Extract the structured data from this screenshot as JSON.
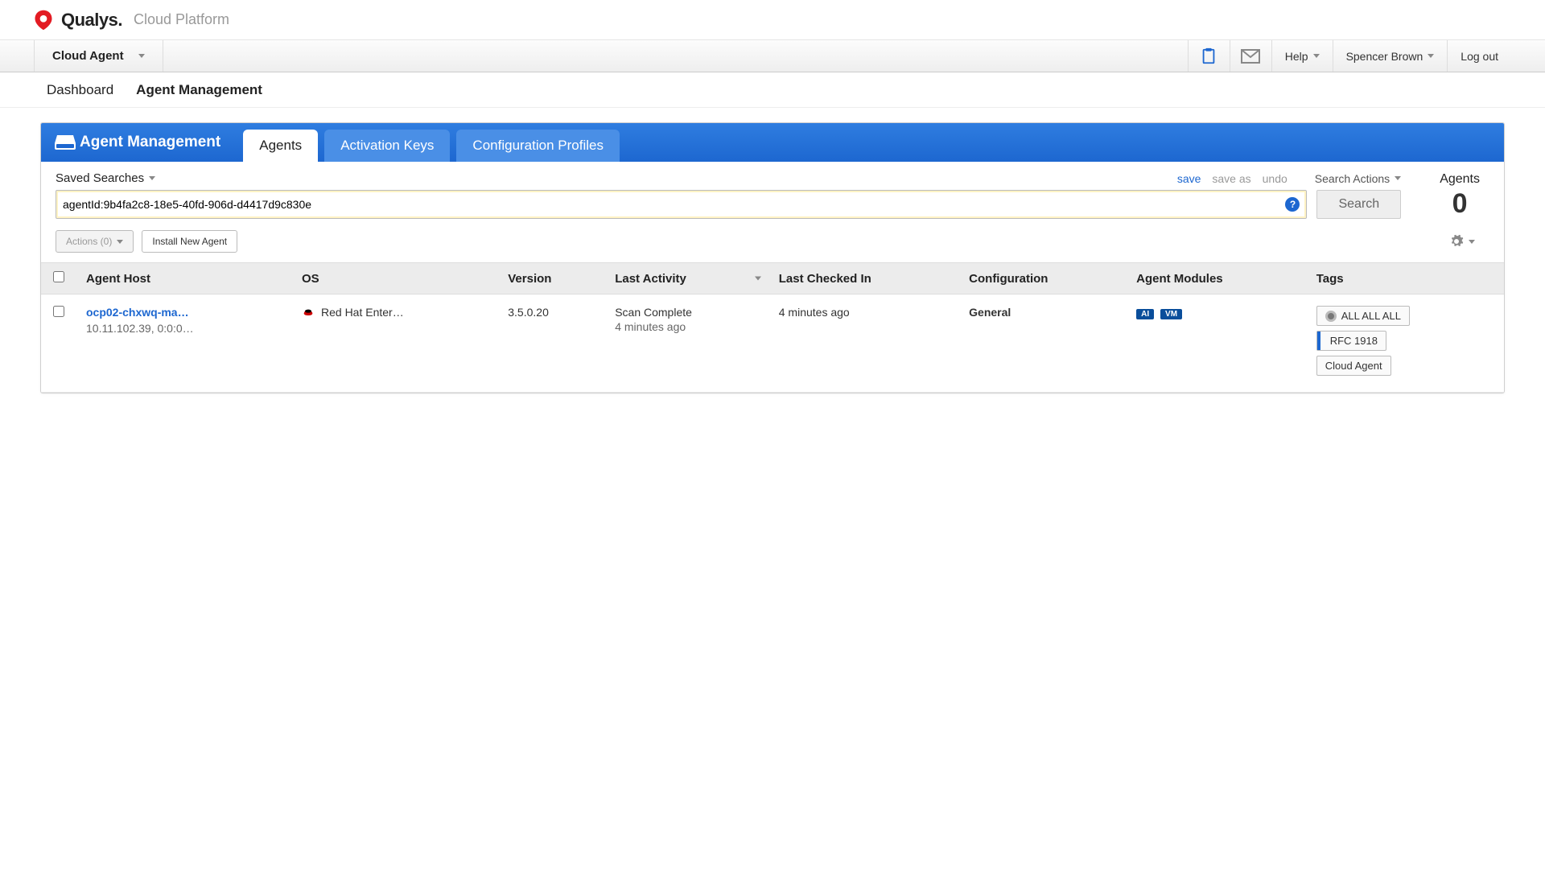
{
  "brand": {
    "name": "Qualys.",
    "sub": "Cloud Platform"
  },
  "topbar": {
    "product": "Cloud Agent",
    "help": "Help",
    "user": "Spencer Brown",
    "logout": "Log out"
  },
  "secondaryNav": {
    "items": [
      "Dashboard",
      "Agent Management"
    ],
    "activeIndex": 1
  },
  "blueHeader": {
    "title": "Agent Management",
    "tabs": [
      "Agents",
      "Activation Keys",
      "Configuration Profiles"
    ],
    "activeIndex": 0
  },
  "searchArea": {
    "savedSearches": "Saved Searches",
    "save": "save",
    "saveAs": "save as",
    "undo": "undo",
    "searchActions": "Search Actions",
    "agentsLabel": "Agents",
    "agentsCount": "0",
    "query": "agentId:9b4fa2c8-18e5-40fd-906d-d4417d9c830e",
    "searchBtn": "Search"
  },
  "actions": {
    "bulk": "Actions (0)",
    "install": "Install New Agent"
  },
  "table": {
    "headers": {
      "host": "Agent Host",
      "os": "OS",
      "version": "Version",
      "lastActivity": "Last Activity",
      "lastCheckedIn": "Last Checked In",
      "configuration": "Configuration",
      "modules": "Agent Modules",
      "tags": "Tags"
    },
    "rows": [
      {
        "host": "ocp02-chxwq-ma…",
        "ips": "10.11.102.39, 0:0:0…",
        "os": "Red Hat Enter…",
        "version": "3.5.0.20",
        "lastActivity": "Scan Complete",
        "lastActivityTime": "4 minutes ago",
        "lastCheckedIn": "4 minutes ago",
        "configuration": "General",
        "modules": [
          "AI",
          "VM"
        ],
        "tags": [
          "ALL ALL ALL",
          "RFC 1918",
          "Cloud Agent"
        ]
      }
    ]
  }
}
